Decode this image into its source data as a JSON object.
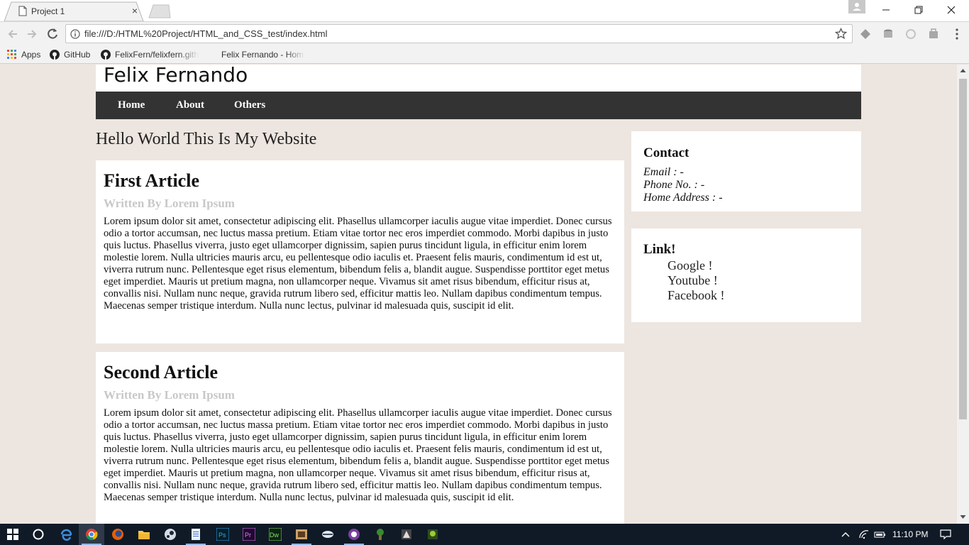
{
  "browser": {
    "tab_title": "Project 1",
    "tab_close": "×",
    "url": "file:///D:/HTML%20Project/HTML_and_CSS_test/index.html",
    "bookmarks": [
      {
        "label": "Apps",
        "icon": "apps-grid-icon"
      },
      {
        "label": "GitHub",
        "icon": "github-icon"
      },
      {
        "label": "FelixFern/felixfern.githu",
        "icon": "github-icon"
      },
      {
        "label": "Felix Fernando - Hom",
        "icon": "page-icon"
      }
    ]
  },
  "site": {
    "title": "Felix Fernando",
    "nav": [
      "Home",
      "About",
      "Others"
    ],
    "heading": "Hello World This Is My Website"
  },
  "articles": [
    {
      "title": "First Article",
      "byline": "Written By Lorem Ipsum",
      "body": "Lorem ipsum dolor sit amet, consectetur adipiscing elit. Phasellus ullamcorper iaculis augue vitae imperdiet. Donec cursus odio a tortor accumsan, nec luctus massa pretium. Etiam vitae tortor nec eros imperdiet commodo. Morbi dapibus in justo quis luctus. Phasellus viverra, justo eget ullamcorper dignissim, sapien purus tincidunt ligula, in efficitur enim lorem molestie lorem. Nulla ultricies mauris arcu, eu pellentesque odio iaculis et. Praesent felis mauris, condimentum id est ut, viverra rutrum nunc. Pellentesque eget risus elementum, bibendum felis a, blandit augue. Suspendisse porttitor eget metus eget imperdiet. Mauris ut pretium magna, non ullamcorper neque. Vivamus sit amet risus bibendum, efficitur risus at, convallis nisi. Nullam nunc neque, gravida rutrum libero sed, efficitur mattis leo. Nullam dapibus condimentum tempus. Maecenas semper tristique interdum. Nulla nunc lectus, pulvinar id malesuada quis, suscipit id elit."
    },
    {
      "title": "Second Article",
      "byline": "Written By Lorem Ipsum",
      "body": "Lorem ipsum dolor sit amet, consectetur adipiscing elit. Phasellus ullamcorper iaculis augue vitae imperdiet. Donec cursus odio a tortor accumsan, nec luctus massa pretium. Etiam vitae tortor nec eros imperdiet commodo. Morbi dapibus in justo quis luctus. Phasellus viverra, justo eget ullamcorper dignissim, sapien purus tincidunt ligula, in efficitur enim lorem molestie lorem. Nulla ultricies mauris arcu, eu pellentesque odio iaculis et. Praesent felis mauris, condimentum id est ut, viverra rutrum nunc. Pellentesque eget risus elementum, bibendum felis a, blandit augue. Suspendisse porttitor eget metus eget imperdiet. Mauris ut pretium magna, non ullamcorper neque. Vivamus sit amet risus bibendum, efficitur risus at, convallis nisi. Nullam nunc neque, gravida rutrum libero sed, efficitur mattis leo. Nullam dapibus condimentum tempus. Maecenas semper tristique interdum. Nulla nunc lectus, pulvinar id malesuada quis, suscipit id elit."
    }
  ],
  "contact": {
    "title": "Contact",
    "lines": [
      "Email : -",
      "Phone No. : -",
      "Home Address : -"
    ]
  },
  "links": {
    "title": "Link!",
    "items": [
      "Google !",
      "Youtube !",
      "Facebook !"
    ]
  },
  "taskbar": {
    "time": "11:10 PM",
    "apps": [
      "windows-start-icon",
      "cortana-icon",
      "edge-icon",
      "chrome-icon",
      "firefox-icon",
      "file-explorer-icon",
      "steam-icon",
      "notepad-icon",
      "photoshop-icon",
      "premiere-icon",
      "dreamweaver-icon",
      "app-icon",
      "app-icon",
      "app-icon",
      "app-icon",
      "app-icon",
      "app-icon"
    ],
    "app_labels": {
      "photoshop": "Ps",
      "premiere": "Pr",
      "dreamweaver": "Dw"
    }
  },
  "colors": {
    "page_bg": "#ede5df",
    "nav_bg": "#333333",
    "byline": "#c8c8c8",
    "taskbar": "#101a27"
  }
}
